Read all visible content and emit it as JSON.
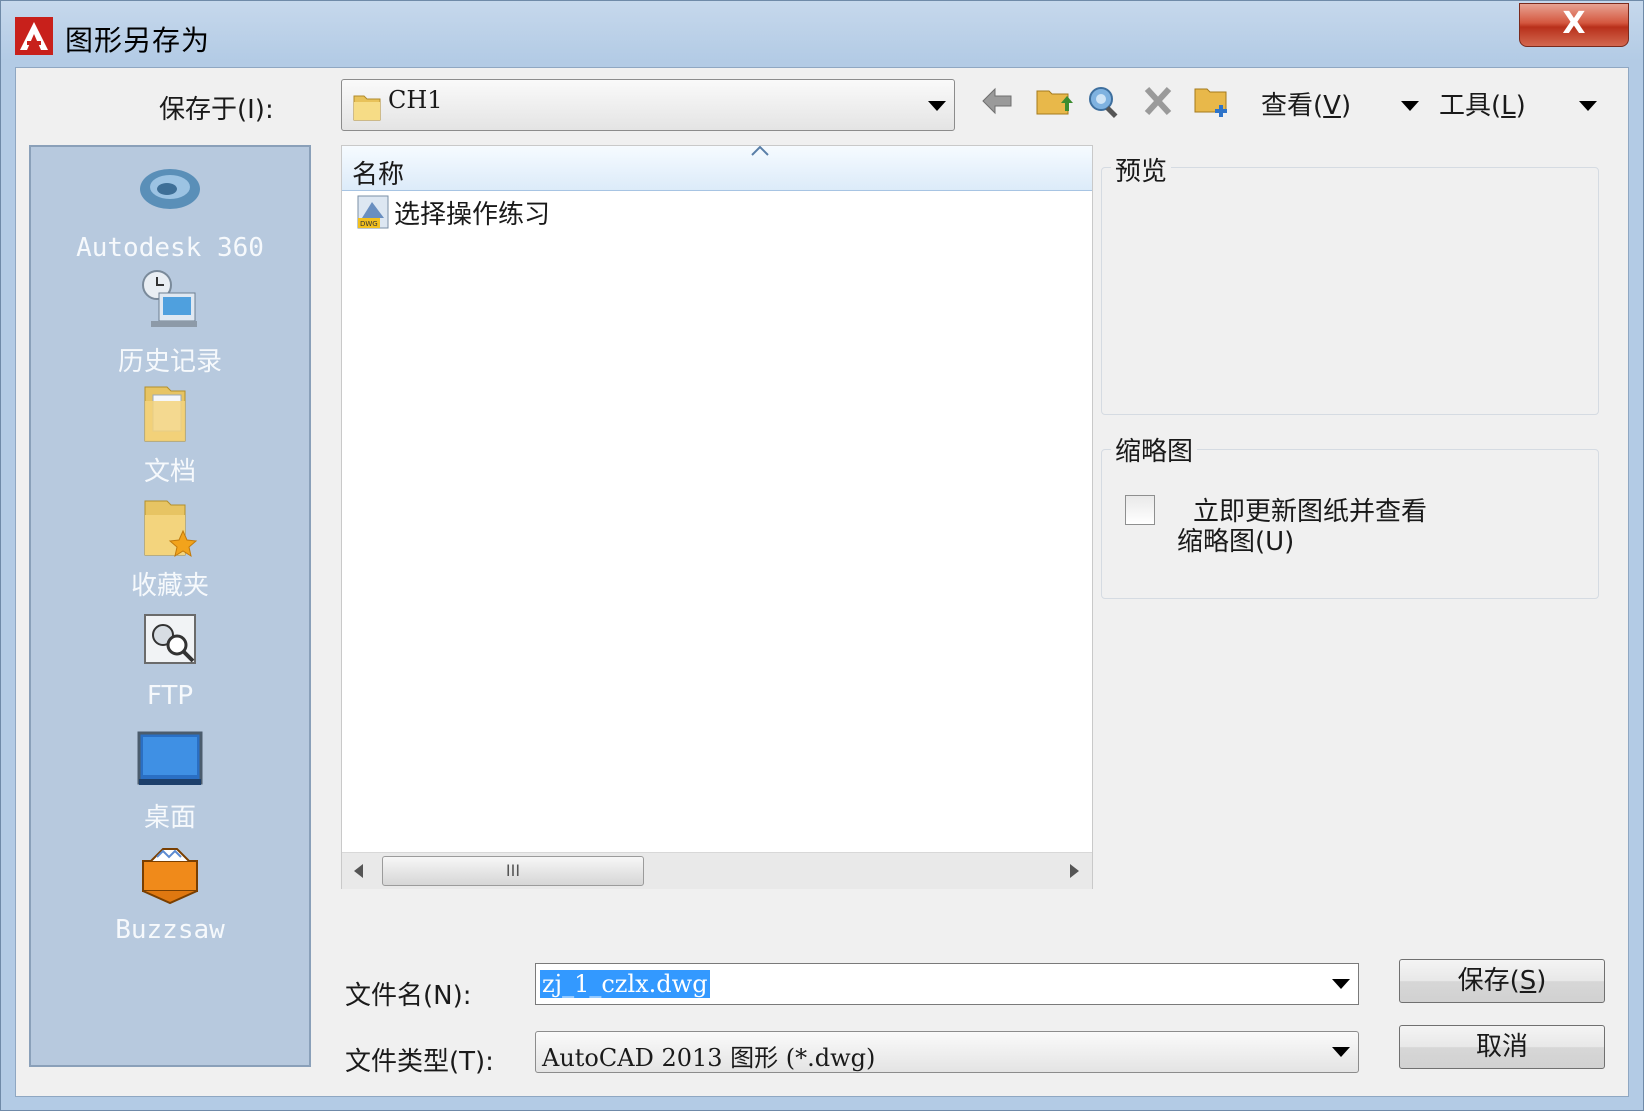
{
  "window": {
    "title": "图形另存为",
    "close_label": "X",
    "colors": {
      "accent": "#3399ff",
      "sidebar": "#b7c9de",
      "close": "#c9452c"
    }
  },
  "toolbar": {
    "save_in_label": "保存于(I):",
    "save_in_value": "CH1",
    "icons": [
      "back-arrow-icon",
      "up-folder-icon",
      "search-web-icon",
      "delete-icon",
      "new-folder-icon"
    ],
    "view_label": "查看",
    "view_key": "V",
    "tools_label": "工具",
    "tools_key": "L"
  },
  "places": [
    {
      "label": "Autodesk 360",
      "icon": "autodesk-360-icon"
    },
    {
      "label": "历史记录",
      "icon": "history-icon"
    },
    {
      "label": "文档",
      "icon": "documents-folder-icon"
    },
    {
      "label": "收藏夹",
      "icon": "favorites-folder-icon"
    },
    {
      "label": "FTP",
      "icon": "ftp-icon"
    },
    {
      "label": "桌面",
      "icon": "desktop-icon"
    },
    {
      "label": "Buzzsaw",
      "icon": "buzzsaw-icon"
    }
  ],
  "file_list": {
    "column_header": "名称",
    "items": [
      {
        "name": "选择操作练习",
        "icon": "dwg-file-icon"
      }
    ],
    "scroll_thumb_glyph": "III"
  },
  "preview": {
    "title": "预览"
  },
  "thumbnail": {
    "title": "缩略图",
    "checkbox_line1": "立即更新图纸并查看",
    "checkbox_line2": "缩略图(U)",
    "checked": false
  },
  "filename": {
    "label": "文件名(N):",
    "value": "zj_1_czlx.dwg"
  },
  "filetype": {
    "label": "文件类型(T):",
    "value": "AutoCAD 2013 图形 (*.dwg)"
  },
  "buttons": {
    "save_label": "保存",
    "save_key": "S",
    "cancel_label": "取消"
  }
}
